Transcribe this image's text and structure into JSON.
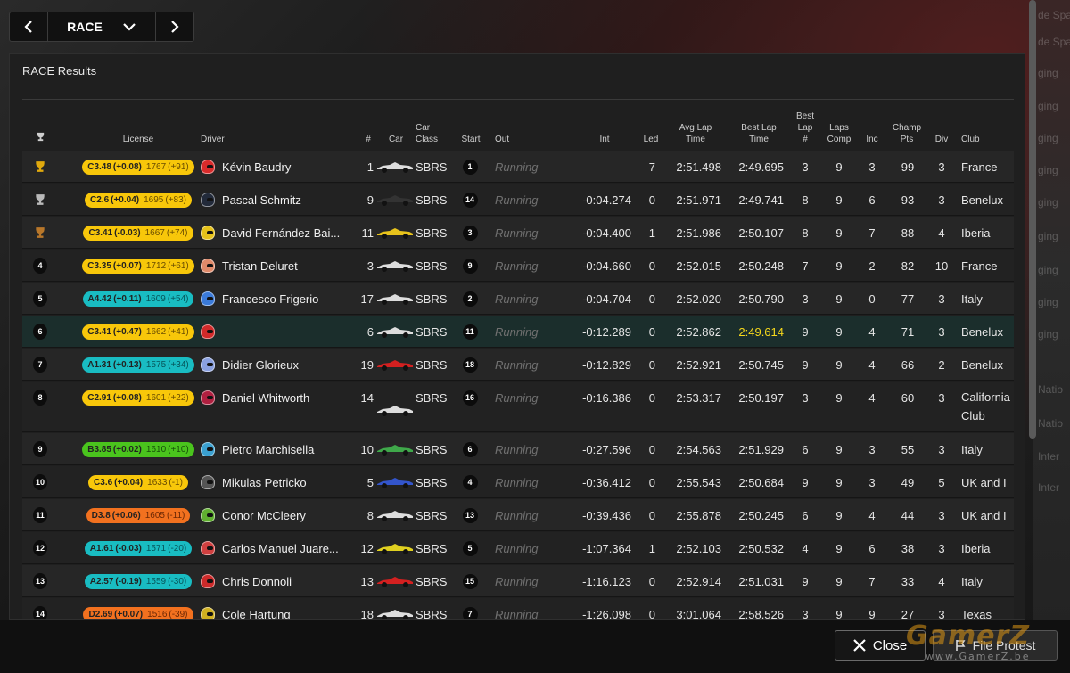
{
  "nav": {
    "session": "RACE"
  },
  "panel": {
    "title": "RACE Results"
  },
  "background_text": [
    "de Spa",
    "de Spa",
    "ging",
    "ging",
    "ging",
    "ging",
    "ging",
    "ging",
    "ging",
    "ging",
    "ging",
    "Natio",
    "Natio",
    "Inter",
    "Inter"
  ],
  "headers": {
    "license": "License",
    "driver": "Driver",
    "num": "#",
    "car": "Car",
    "car_class_1": "Car",
    "car_class_2": "Class",
    "start": "Start",
    "out": "Out",
    "int": "Int",
    "led": "Led",
    "avg_lap_1": "Avg Lap",
    "avg_lap_2": "Time",
    "best_lap_1": "Best Lap",
    "best_lap_2": "Time",
    "best_lap_num_1": "Best",
    "best_lap_num_2": "Lap",
    "best_lap_num_3": "#",
    "laps_comp_1": "Laps",
    "laps_comp_2": "Comp",
    "inc": "Inc",
    "champ_pts_1": "Champ",
    "champ_pts_2": "Pts",
    "div": "Div",
    "club": "Club"
  },
  "rows": [
    {
      "pos": "1",
      "trophy": "gold",
      "lic_class": "C",
      "lic": "C3.48",
      "lic_delta": "(+0.08)",
      "irating": "1767",
      "ir_delta": "(+91)",
      "helmet": "#d92b2b",
      "driver": "Kévin Baudry",
      "num": "1",
      "car_color": "#dddddd",
      "car_class": "SBRS",
      "start": "1",
      "out": "Running",
      "int": "",
      "led": "7",
      "avg": "2:51.498",
      "best": "2:49.695",
      "best_lap": "3",
      "laps": "9",
      "inc": "3",
      "pts": "99",
      "div": "3",
      "club": "France"
    },
    {
      "pos": "2",
      "trophy": "silver",
      "lic_class": "C",
      "lic": "C2.6",
      "lic_delta": "(+0.04)",
      "irating": "1695",
      "ir_delta": "(+83)",
      "helmet": "#222a3a",
      "driver": "Pascal Schmitz",
      "num": "9",
      "car_color": "#333333",
      "car_class": "SBRS",
      "start": "14",
      "out": "Running",
      "int": "-0:04.274",
      "led": "0",
      "avg": "2:51.971",
      "best": "2:49.741",
      "best_lap": "8",
      "laps": "9",
      "inc": "6",
      "pts": "93",
      "div": "3",
      "club": "Benelux"
    },
    {
      "pos": "3",
      "trophy": "bronze",
      "lic_class": "C",
      "lic": "C3.41",
      "lic_delta": "(-0.03)",
      "irating": "1667",
      "ir_delta": "(+74)",
      "helmet": "#e6c21a",
      "driver": "David Fernández Bai...",
      "num": "11",
      "car_color": "#e8c31c",
      "car_class": "SBRS",
      "start": "3",
      "out": "Running",
      "int": "-0:04.400",
      "led": "1",
      "avg": "2:51.986",
      "best": "2:50.107",
      "best_lap": "8",
      "laps": "9",
      "inc": "7",
      "pts": "88",
      "div": "4",
      "club": "Iberia"
    },
    {
      "pos": "4",
      "trophy": "",
      "lic_class": "C",
      "lic": "C3.35",
      "lic_delta": "(+0.07)",
      "irating": "1712",
      "ir_delta": "(+61)",
      "helmet": "#e08a6a",
      "driver": "Tristan Deluret",
      "num": "3",
      "car_color": "#dddddd",
      "car_class": "SBRS",
      "start": "9",
      "out": "Running",
      "int": "-0:04.660",
      "led": "0",
      "avg": "2:52.015",
      "best": "2:50.248",
      "best_lap": "7",
      "laps": "9",
      "inc": "2",
      "pts": "82",
      "div": "10",
      "club": "France"
    },
    {
      "pos": "5",
      "trophy": "",
      "lic_class": "A",
      "lic": "A4.42",
      "lic_delta": "(+0.11)",
      "irating": "1609",
      "ir_delta": "(+54)",
      "helmet": "#3a7ad9",
      "driver": "Francesco Frigerio",
      "num": "17",
      "car_color": "#dddddd",
      "car_class": "SBRS",
      "start": "2",
      "out": "Running",
      "int": "-0:04.704",
      "led": "0",
      "avg": "2:52.020",
      "best": "2:50.790",
      "best_lap": "3",
      "laps": "9",
      "inc": "0",
      "pts": "77",
      "div": "3",
      "club": "Italy"
    },
    {
      "pos": "6",
      "trophy": "",
      "lic_class": "C",
      "lic": "C3.41",
      "lic_delta": "(+0.47)",
      "irating": "1662",
      "ir_delta": "(+41)",
      "helmet": "#d12a2a",
      "driver": "",
      "num": "6",
      "car_color": "#dddddd",
      "car_class": "SBRS",
      "start": "11",
      "out": "Running",
      "int": "-0:12.289",
      "led": "0",
      "avg": "2:52.862",
      "best": "2:49.614",
      "best_is_fastest": true,
      "best_lap": "9",
      "laps": "9",
      "inc": "4",
      "pts": "71",
      "div": "3",
      "club": "Benelux"
    },
    {
      "pos": "7",
      "trophy": "",
      "lic_class": "A",
      "lic": "A1.31",
      "lic_delta": "(+0.13)",
      "irating": "1575",
      "ir_delta": "(+34)",
      "helmet": "#8aa0e0",
      "driver": "Didier Glorieux",
      "num": "19",
      "car_color": "#d42020",
      "car_class": "SBRS",
      "start": "18",
      "out": "Running",
      "int": "-0:12.829",
      "led": "0",
      "avg": "2:52.921",
      "best": "2:50.745",
      "best_lap": "9",
      "laps": "9",
      "inc": "4",
      "pts": "66",
      "div": "2",
      "club": "Benelux"
    },
    {
      "pos": "8",
      "trophy": "",
      "lic_class": "C",
      "lic": "C2.91",
      "lic_delta": "(+0.08)",
      "irating": "1601",
      "ir_delta": "(+22)",
      "helmet": "#b02040",
      "driver": "Daniel Whitworth",
      "num": "14",
      "car_color": "#dddddd",
      "car_class": "SBRS",
      "start": "16",
      "out": "Running",
      "int": "-0:16.386",
      "led": "0",
      "avg": "2:53.317",
      "best": "2:50.197",
      "best_lap": "3",
      "laps": "9",
      "inc": "4",
      "pts": "60",
      "div": "3",
      "club": "California Club",
      "tall": true
    },
    {
      "pos": "9",
      "trophy": "",
      "lic_class": "B",
      "lic": "B3.85",
      "lic_delta": "(+0.02)",
      "irating": "1610",
      "ir_delta": "(+10)",
      "helmet": "#3aa0d0",
      "driver": "Pietro Marchisella",
      "num": "10",
      "car_color": "#3fa84a",
      "car_class": "SBRS",
      "start": "6",
      "out": "Running",
      "int": "-0:27.596",
      "led": "0",
      "avg": "2:54.563",
      "best": "2:51.929",
      "best_lap": "6",
      "laps": "9",
      "inc": "3",
      "pts": "55",
      "div": "3",
      "club": "Italy"
    },
    {
      "pos": "10",
      "trophy": "",
      "lic_class": "C",
      "lic": "C3.6",
      "lic_delta": "(+0.04)",
      "irating": "1633",
      "ir_delta": "(-1)",
      "helmet": "#555555",
      "driver": "Mikulas Petricko",
      "num": "5",
      "car_color": "#3355cc",
      "car_class": "SBRS",
      "start": "4",
      "out": "Running",
      "int": "-0:36.412",
      "led": "0",
      "avg": "2:55.543",
      "best": "2:50.684",
      "best_lap": "9",
      "laps": "9",
      "inc": "3",
      "pts": "49",
      "div": "5",
      "club": "UK and I"
    },
    {
      "pos": "11",
      "trophy": "",
      "lic_class": "D",
      "lic": "D3.8",
      "lic_delta": "(+0.06)",
      "irating": "1605",
      "ir_delta": "(-11)",
      "helmet": "#60b030",
      "driver": "Conor McCleery",
      "num": "8",
      "car_color": "#dddddd",
      "car_class": "SBRS",
      "start": "13",
      "out": "Running",
      "int": "-0:39.436",
      "led": "0",
      "avg": "2:55.878",
      "best": "2:50.245",
      "best_lap": "6",
      "laps": "9",
      "inc": "4",
      "pts": "44",
      "div": "3",
      "club": "UK and I"
    },
    {
      "pos": "12",
      "trophy": "",
      "lic_class": "A",
      "lic": "A1.61",
      "lic_delta": "(-0.03)",
      "irating": "1571",
      "ir_delta": "(-20)",
      "helmet": "#d04040",
      "driver": "Carlos Manuel Juare...",
      "num": "12",
      "car_color": "#e0d020",
      "car_class": "SBRS",
      "start": "5",
      "out": "Running",
      "int": "-1:07.364",
      "led": "1",
      "avg": "2:52.103",
      "best": "2:50.532",
      "best_lap": "4",
      "laps": "9",
      "inc": "6",
      "pts": "38",
      "div": "3",
      "club": "Iberia"
    },
    {
      "pos": "13",
      "trophy": "",
      "lic_class": "A",
      "lic": "A2.57",
      "lic_delta": "(-0.19)",
      "irating": "1559",
      "ir_delta": "(-30)",
      "helmet": "#cc2a2a",
      "driver": "Chris Donnoli",
      "num": "13",
      "car_color": "#d42020",
      "car_class": "SBRS",
      "start": "15",
      "out": "Running",
      "int": "-1:16.123",
      "led": "0",
      "avg": "2:52.914",
      "best": "2:51.031",
      "best_lap": "9",
      "laps": "9",
      "inc": "7",
      "pts": "33",
      "div": "4",
      "club": "Italy"
    },
    {
      "pos": "14",
      "trophy": "",
      "lic_class": "D",
      "lic": "D2.69",
      "lic_delta": "(+0.07)",
      "irating": "1516",
      "ir_delta": "(-39)",
      "helmet": "#d0b020",
      "driver": "Cole Hartung",
      "num": "18",
      "car_color": "#dddddd",
      "car_class": "SBRS",
      "start": "7",
      "out": "Running",
      "int": "-1:26.098",
      "led": "0",
      "avg": "3:01.064",
      "best": "2:58.526",
      "best_lap": "3",
      "laps": "9",
      "inc": "9",
      "pts": "27",
      "div": "3",
      "club": "Texas"
    }
  ],
  "footer": {
    "close_label": "Close",
    "protest_label": "File Protest"
  },
  "watermark": {
    "main": "GamerZ",
    "sub": "www.GamerZ.be"
  },
  "colors": {
    "fastest_lap": "#f6d81c",
    "highlight_row": "#1b2e2c"
  }
}
